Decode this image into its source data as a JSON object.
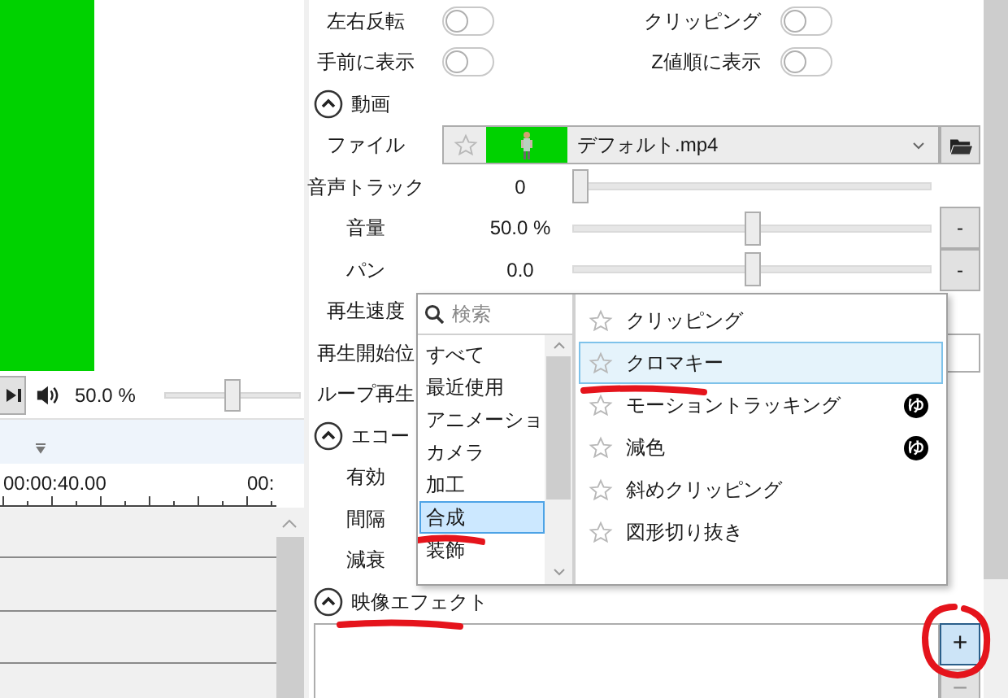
{
  "player": {
    "volume_text": "50.0 %",
    "volume": {
      "level": 0.5
    }
  },
  "timeline": {
    "time_labels": [
      "00:00:40.00",
      "00:"
    ]
  },
  "toggles": [
    {
      "label": "左右反転",
      "on": false
    },
    {
      "label": "クリッピング",
      "on": false
    },
    {
      "label": "手前に表示",
      "on": false
    },
    {
      "label": "Z値順に表示",
      "on": false
    }
  ],
  "sections": [
    {
      "title": "動画",
      "expanded": true,
      "marked": false,
      "rows": [
        {
          "kind": "file",
          "label": "ファイル",
          "value": "デフォルト.mp4"
        },
        {
          "kind": "slider",
          "label": "音声トラック",
          "value": "0",
          "level": 0
        },
        {
          "kind": "slider",
          "label": "音量",
          "value": "50.0 %",
          "level": 0.5,
          "reset_button": "-"
        },
        {
          "kind": "slider",
          "label": "パン",
          "value": "0.0",
          "level": 0.5,
          "reset_button": "-"
        },
        {
          "kind": "label",
          "label": "再生速度"
        },
        {
          "kind": "field",
          "label": "再生開始位"
        },
        {
          "kind": "label",
          "label": "ループ再生"
        }
      ]
    },
    {
      "title": "エコー",
      "expanded": true,
      "marked": false,
      "rows": [
        {
          "kind": "label",
          "label": "有効"
        },
        {
          "kind": "label",
          "label": "間隔"
        },
        {
          "kind": "label",
          "label": "減衰"
        }
      ]
    },
    {
      "title": "映像エフェクト",
      "expanded": true,
      "marked": true
    }
  ],
  "effects_box": {
    "add_button": {
      "label": "+",
      "marked": true
    },
    "remove_button": {
      "label": "−"
    }
  },
  "popup": {
    "search_placeholder": "検索",
    "categories": [
      {
        "label": "すべて",
        "selected": false,
        "marked": false
      },
      {
        "label": "最近使用",
        "selected": false,
        "marked": false
      },
      {
        "label": "アニメーショ",
        "selected": false,
        "marked": false
      },
      {
        "label": "カメラ",
        "selected": false,
        "marked": false
      },
      {
        "label": "加工",
        "selected": false,
        "marked": false
      },
      {
        "label": "合成",
        "selected": true,
        "marked": true
      },
      {
        "label": "装飾",
        "selected": false,
        "marked": false
      }
    ],
    "effects": [
      {
        "label": "クリッピング",
        "selected": false,
        "marked": false
      },
      {
        "label": "クロマキー",
        "selected": true,
        "marked": true
      },
      {
        "label": "モーショントラッキング",
        "selected": false,
        "marked": false,
        "badge": "ゆ"
      },
      {
        "label": "減色",
        "selected": false,
        "marked": false,
        "badge": "ゆ"
      },
      {
        "label": "斜めクリッピング",
        "selected": false,
        "marked": false
      },
      {
        "label": "図形切り抜き",
        "selected": false,
        "marked": false
      }
    ]
  }
}
